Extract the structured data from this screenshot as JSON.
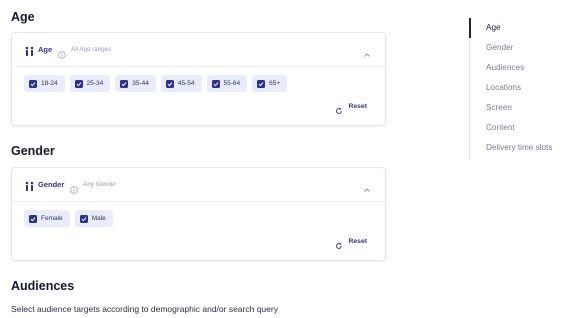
{
  "sections": {
    "age": {
      "title": "Age",
      "card": {
        "label": "Age",
        "summary": "All Age ranges",
        "options": [
          "18-24",
          "25-34",
          "35-44",
          "45-54",
          "55-64",
          "65+"
        ],
        "reset_label": "Reset"
      }
    },
    "gender": {
      "title": "Gender",
      "card": {
        "label": "Gender",
        "summary": "Any Gender",
        "options": [
          "Female",
          "Male"
        ],
        "reset_label": "Reset"
      }
    },
    "audiences": {
      "title": "Audiences",
      "description": "Select audience targets according to demographic and/or search query"
    }
  },
  "toc": {
    "active": "Age",
    "items": [
      "Age",
      "Gender",
      "Audiences",
      "Locations",
      "Screen",
      "Content",
      "Delivery time slots"
    ]
  },
  "colors": {
    "accent": "#2f2f9a",
    "chip_bg": "#e9ecfb",
    "muted_text": "#7b7e90"
  },
  "icons": {
    "card_header": "people-icon",
    "info": "info-icon",
    "collapse": "chevron-up-icon",
    "checkbox": "checkbox-checked-icon",
    "reset": "refresh-icon"
  }
}
